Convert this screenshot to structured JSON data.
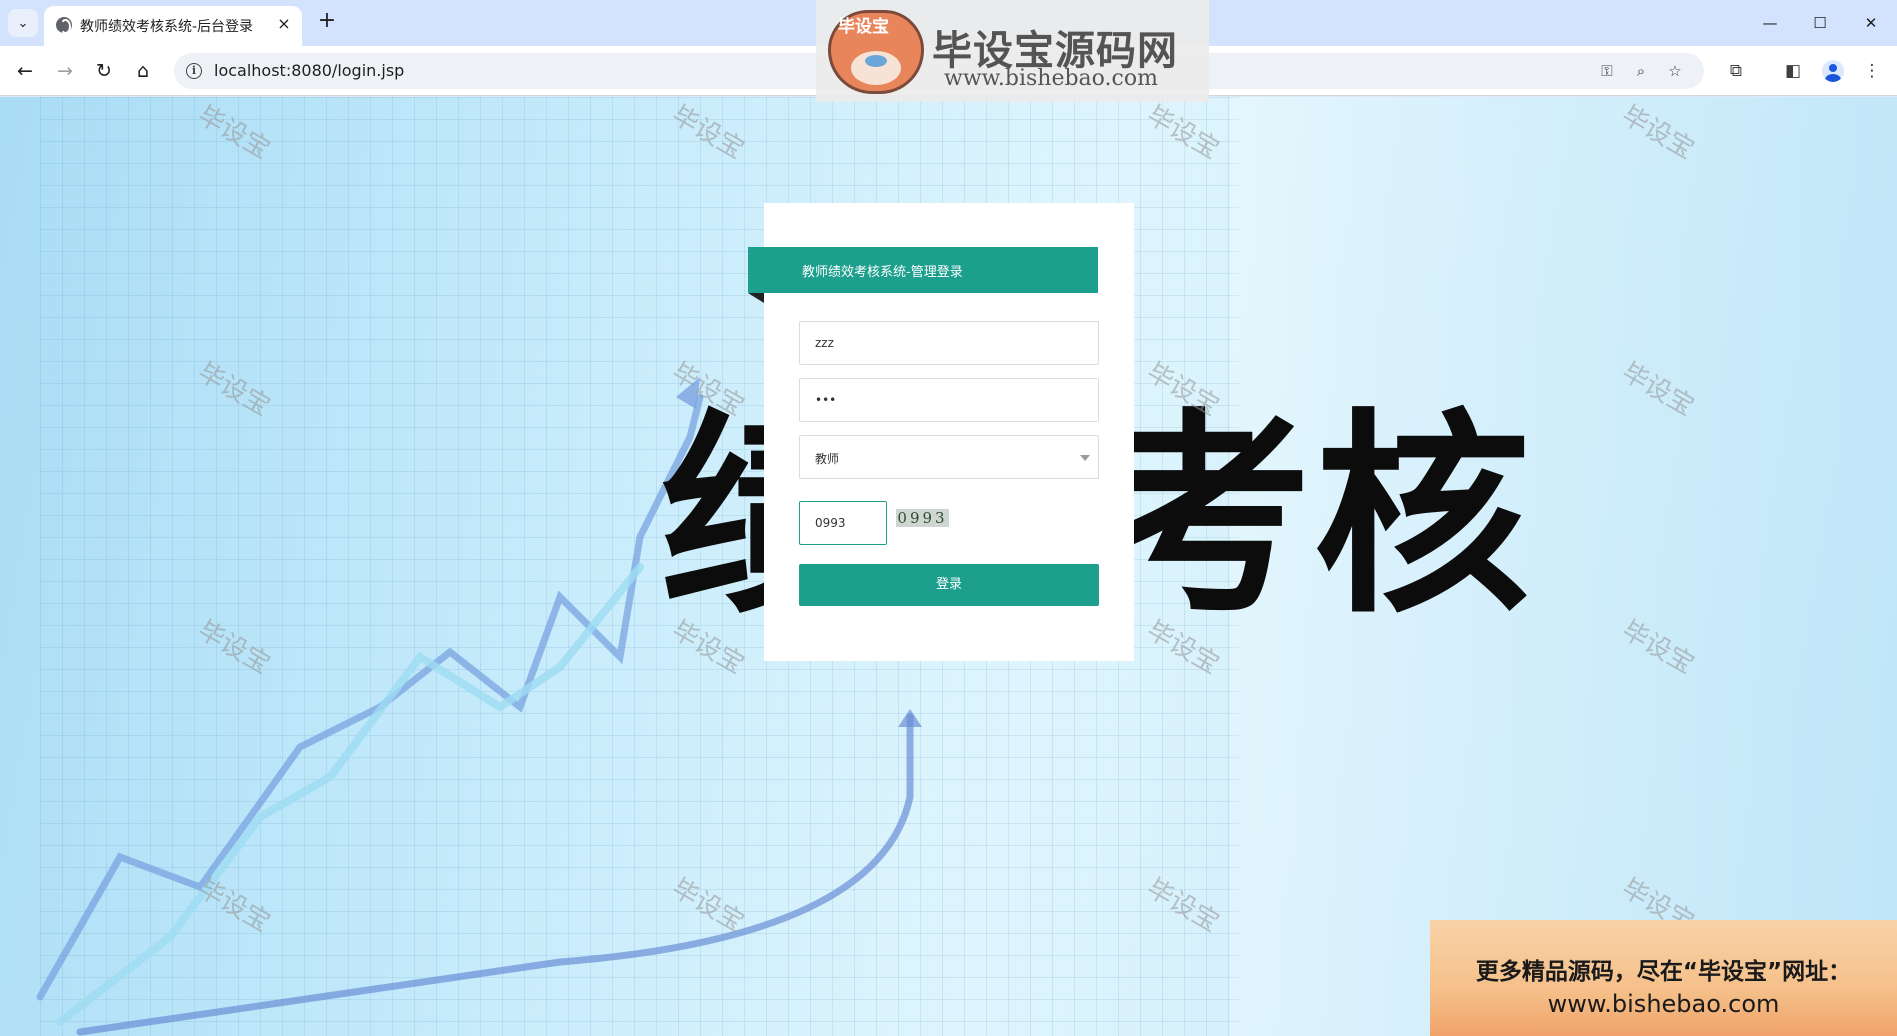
{
  "browser": {
    "tab_title": "教师绩效考核系统-后台登录",
    "new_tab_symbol": "+",
    "close_tab_symbol": "×",
    "url": "localhost:8080/login.jsp",
    "window_controls": {
      "minimize": "—",
      "maximize": "☐",
      "close": "✕"
    }
  },
  "login": {
    "header": "教师绩效考核系统-管理登录",
    "username_value": "zzz",
    "password_value": "•••",
    "role_selected": "教师",
    "captcha_input_value": "0993",
    "captcha_image_text": "0993",
    "submit_label": "登录"
  },
  "background": {
    "banner_text": "绩效考核",
    "watermark_text": "毕设宝"
  },
  "overlays": {
    "logo_badge": "毕设宝",
    "logo_name": "毕设宝源码网",
    "logo_url": "www.bishebao.com",
    "promo_line1": "更多精品源码，尽在“毕设宝”网址：",
    "promo_line2": "www.bishebao.com"
  },
  "colors": {
    "accent": "#1d9f8e",
    "tabbar": "#d3e3fd"
  }
}
